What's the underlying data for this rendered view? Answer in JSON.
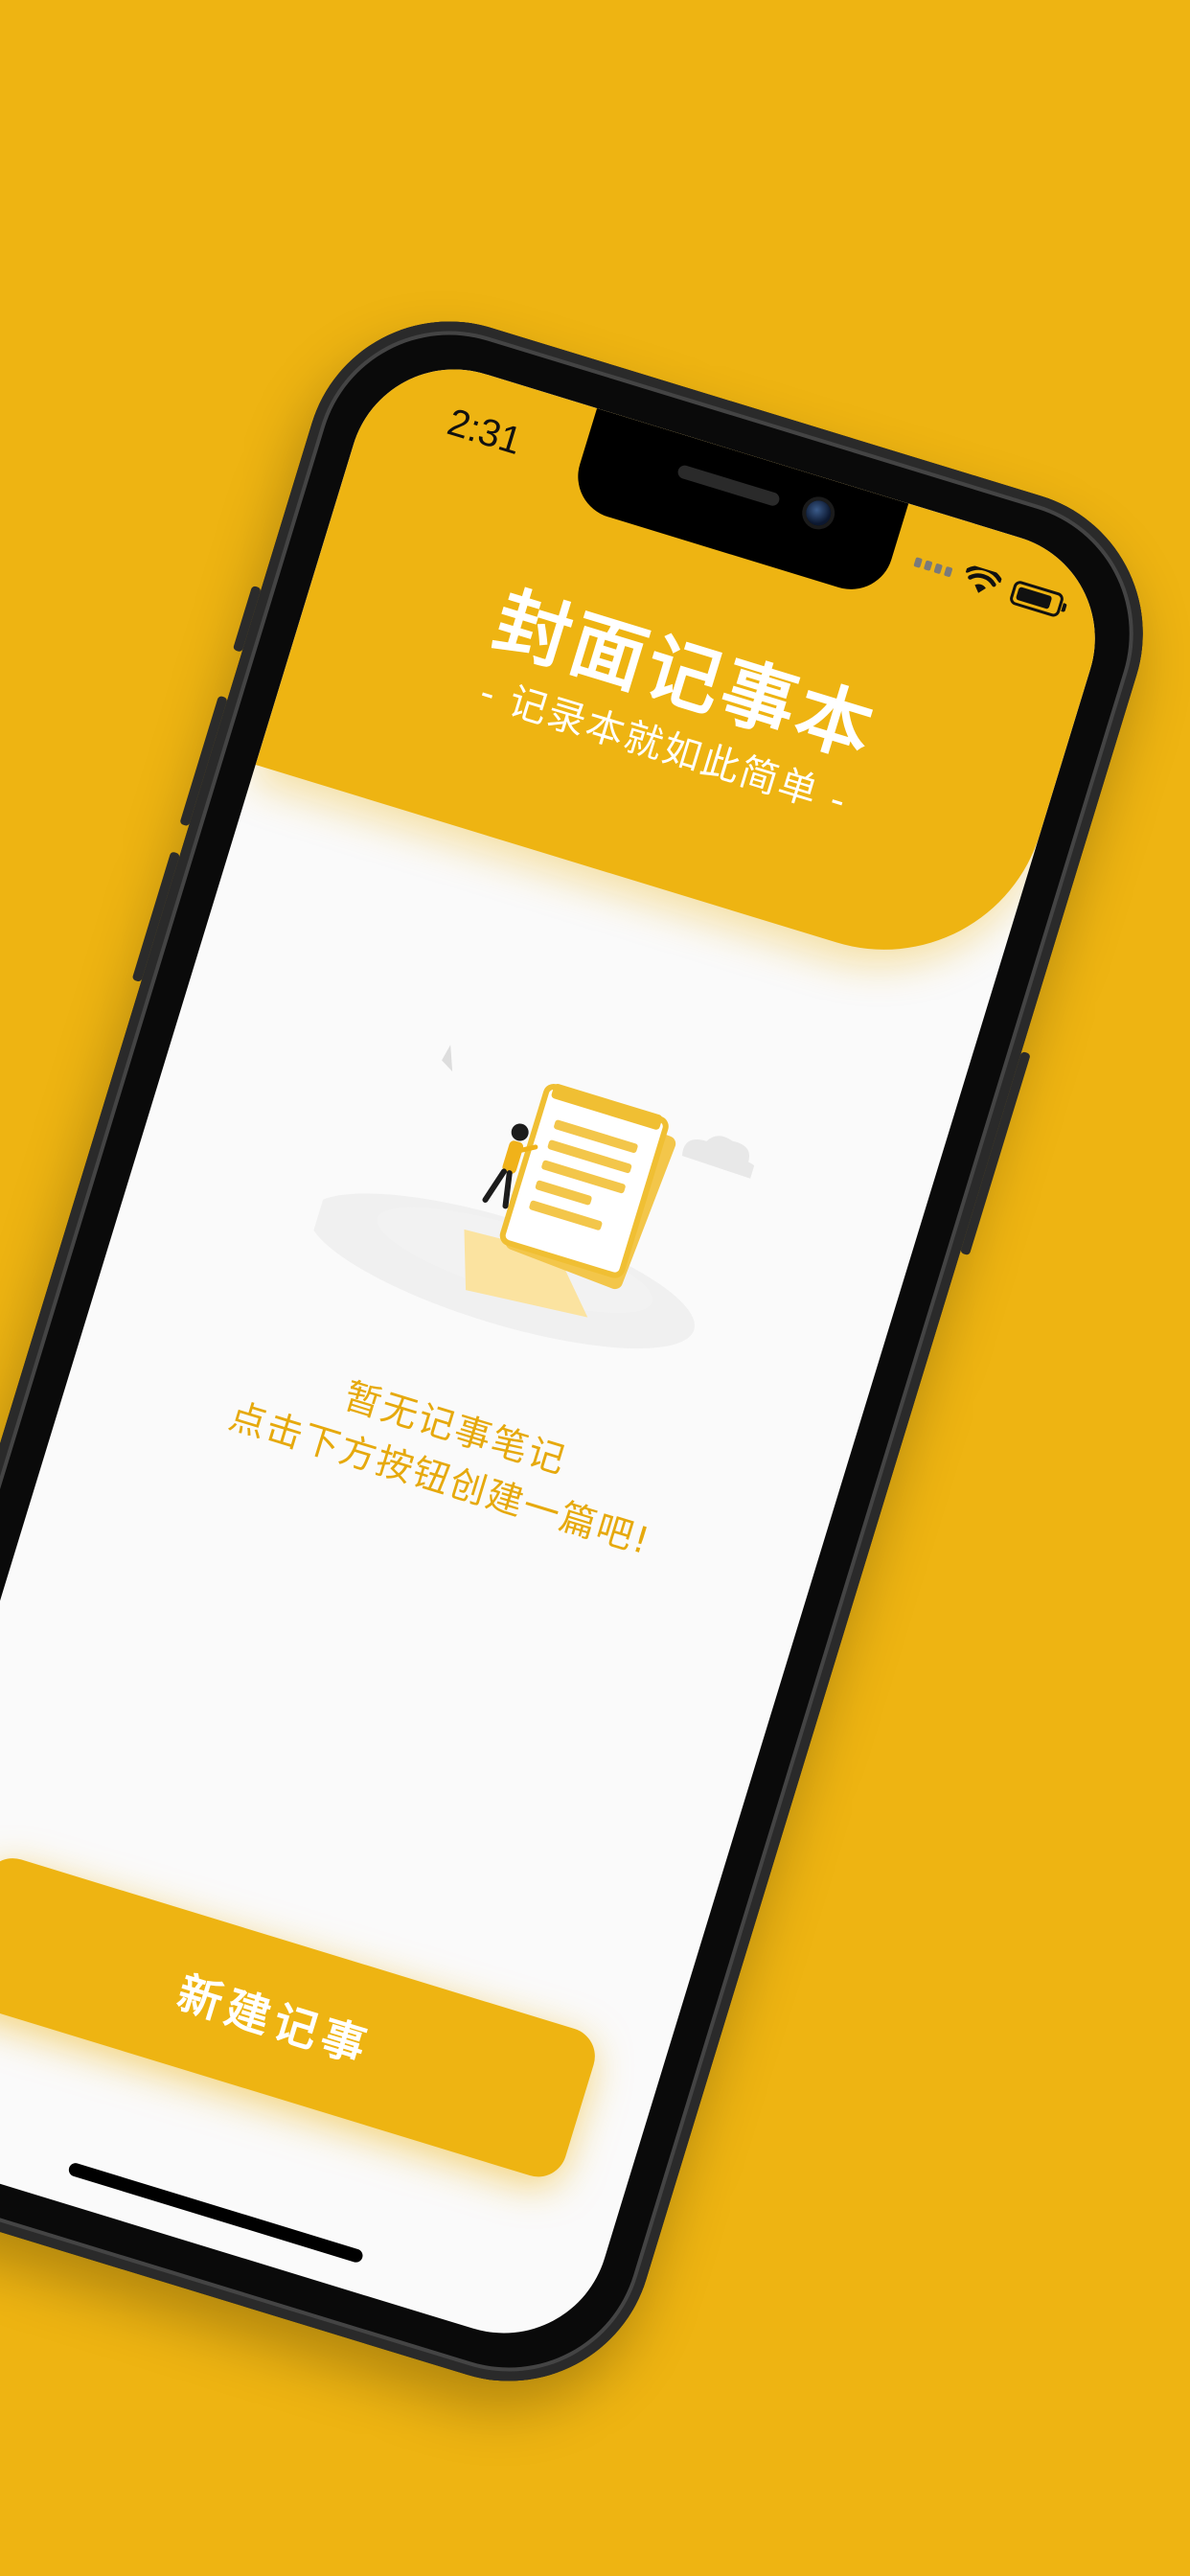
{
  "status_bar": {
    "time": "2:31"
  },
  "header": {
    "title": "封面记事本",
    "subtitle": "- 记录本就如此简单 -"
  },
  "empty_state": {
    "title": "暂无记事笔记",
    "hint": "点击下方按钮创建一篇吧!"
  },
  "actions": {
    "new_note_label": "新建记事"
  },
  "icons": {
    "illustration": "notepad-illustration-icon",
    "wifi": "wifi-icon",
    "battery": "battery-icon",
    "signal": "signal-icon"
  },
  "colors": {
    "background": "#EEB412",
    "accent": "#EEB412",
    "accent_text": "#E6A90D",
    "screen_bg": "#FAFAFA"
  }
}
